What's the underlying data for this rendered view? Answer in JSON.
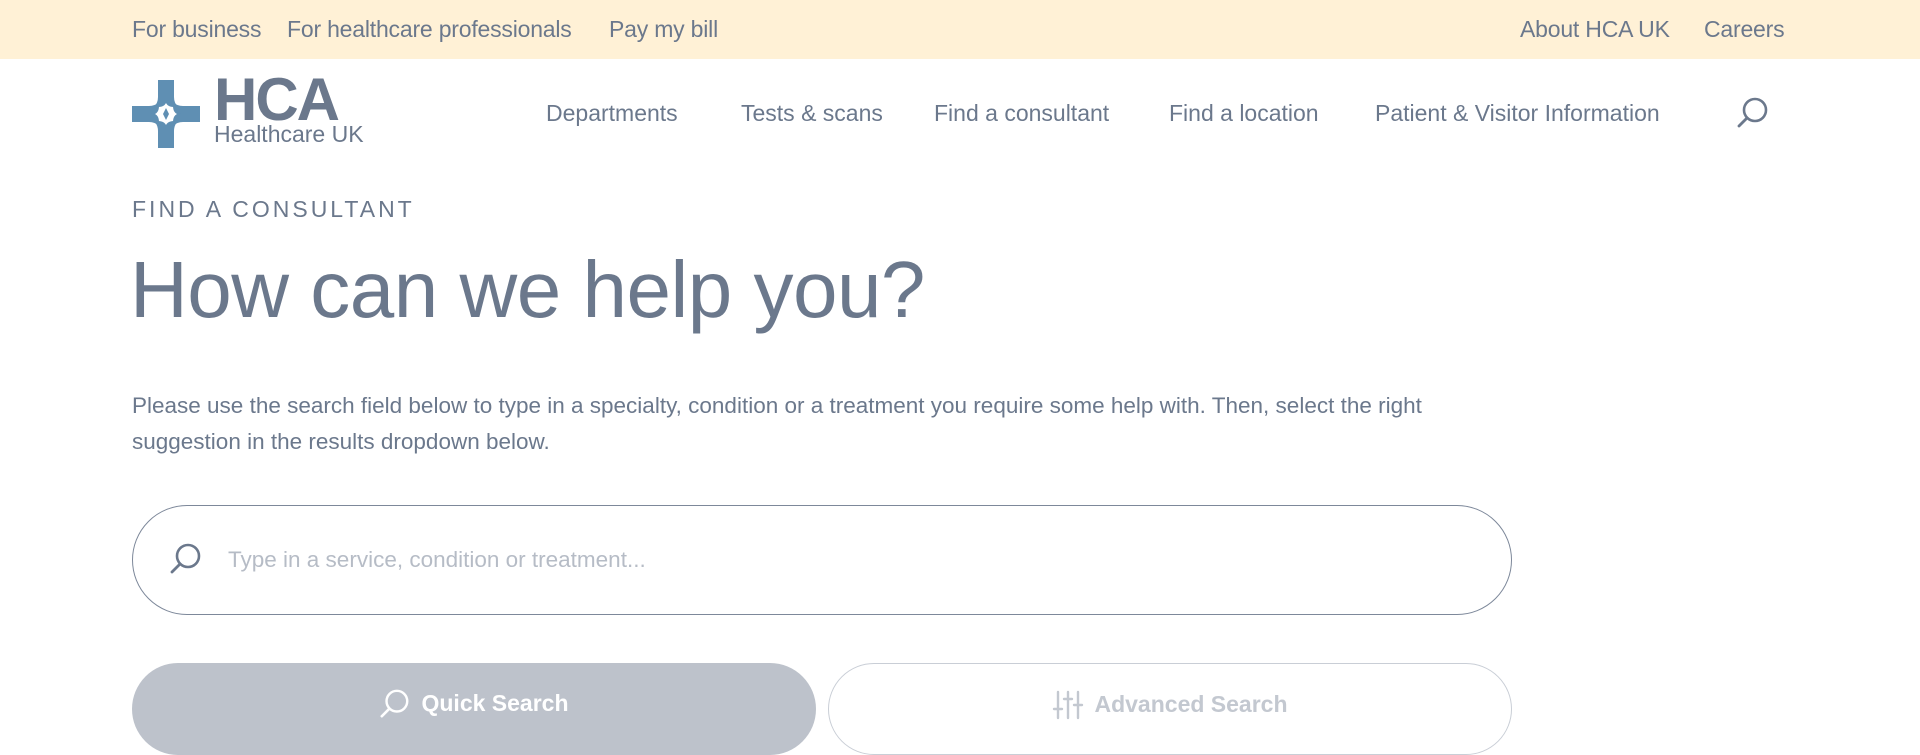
{
  "topbar": {
    "left_links": [
      "For business",
      "For healthcare professionals",
      "Pay my bill"
    ],
    "right_links": [
      "About HCA UK",
      "Careers"
    ]
  },
  "logo": {
    "main": "HCA",
    "sub": "Healthcare UK"
  },
  "nav": {
    "items": [
      "Departments",
      "Tests & scans",
      "Find a consultant",
      "Find a location",
      "Patient & Visitor Information"
    ],
    "search_icon": "search-icon"
  },
  "hero": {
    "eyebrow": "FIND A CONSULTANT",
    "headline": "How can we help you?",
    "intro": "Please use the search field below to type in a specialty, condition or a treatment you require some help with.  Then, select the right suggestion in the results dropdown below."
  },
  "search": {
    "placeholder": "Type in a service, condition or treatment...",
    "value": ""
  },
  "buttons": {
    "quick": "Quick Search",
    "advanced": "Advanced Search"
  },
  "colors": {
    "topbar_bg": "#fff1d6",
    "text": "#6b788c",
    "logo_blue": "#5f8fb3",
    "quick_bg": "#bdc2cb"
  }
}
